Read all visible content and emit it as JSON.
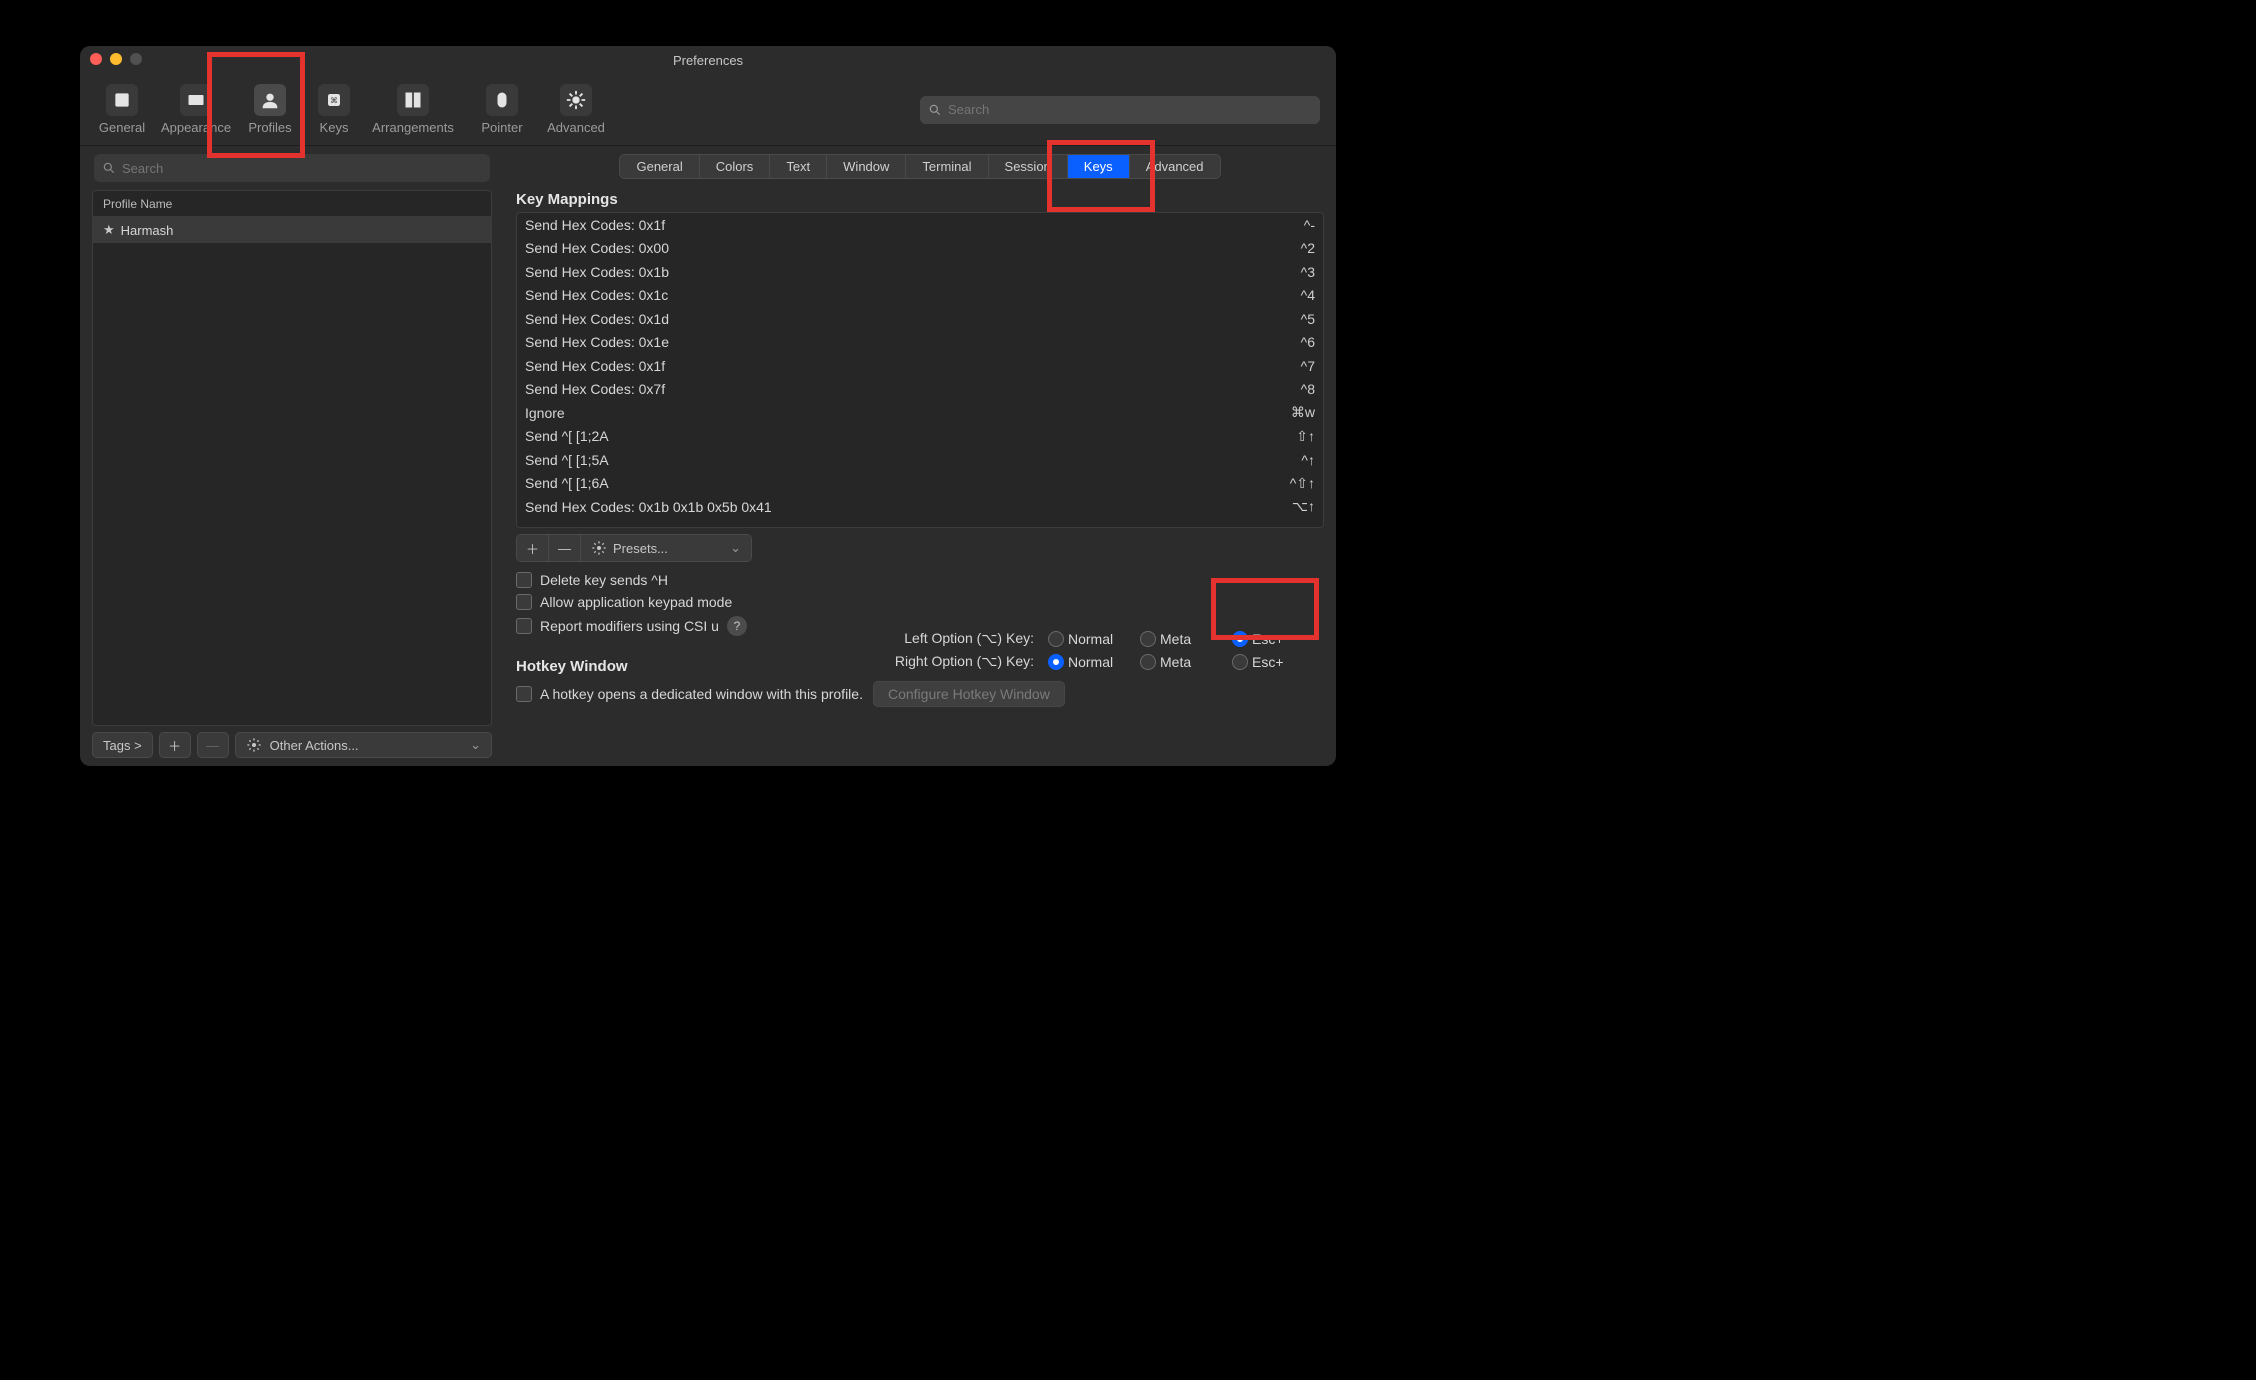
{
  "window": {
    "title": "Preferences"
  },
  "toolbar": {
    "items": [
      {
        "label": "General"
      },
      {
        "label": "Appearance"
      },
      {
        "label": "Profiles"
      },
      {
        "label": "Keys"
      },
      {
        "label": "Arrangements"
      },
      {
        "label": "Pointer"
      },
      {
        "label": "Advanced"
      }
    ],
    "search_placeholder": "Search"
  },
  "sidebar": {
    "search_placeholder": "Search",
    "header": "Profile Name",
    "rows": [
      "Harmash"
    ],
    "tags_label": "Tags >",
    "other_actions": "Other Actions..."
  },
  "tabs": [
    "General",
    "Colors",
    "Text",
    "Window",
    "Terminal",
    "Session",
    "Keys",
    "Advanced"
  ],
  "active_tab": "Keys",
  "key_mappings": {
    "heading": "Key Mappings",
    "rows": [
      {
        "action": "Send Hex Codes: 0x1f",
        "shortcut": "^-"
      },
      {
        "action": "Send Hex Codes: 0x00",
        "shortcut": "^2"
      },
      {
        "action": "Send Hex Codes: 0x1b",
        "shortcut": "^3"
      },
      {
        "action": "Send Hex Codes: 0x1c",
        "shortcut": "^4"
      },
      {
        "action": "Send Hex Codes: 0x1d",
        "shortcut": "^5"
      },
      {
        "action": "Send Hex Codes: 0x1e",
        "shortcut": "^6"
      },
      {
        "action": "Send Hex Codes: 0x1f",
        "shortcut": "^7"
      },
      {
        "action": "Send Hex Codes: 0x7f",
        "shortcut": "^8"
      },
      {
        "action": "Ignore",
        "shortcut": "⌘w"
      },
      {
        "action": "Send ^[ [1;2A",
        "shortcut": "⇧↑"
      },
      {
        "action": "Send ^[ [1;5A",
        "shortcut": "^↑"
      },
      {
        "action": "Send ^[ [1;6A",
        "shortcut": "^⇧↑"
      },
      {
        "action": "Send Hex Codes: 0x1b 0x1b 0x5b 0x41",
        "shortcut": "⌥↑"
      }
    ],
    "presets_label": "Presets..."
  },
  "checks": {
    "delete_sends_hH": "Delete key sends ^H",
    "allow_keypad": "Allow application keypad mode",
    "csi_u": "Report modifiers using CSI u"
  },
  "option_keys": {
    "left_label": "Left Option (⌥) Key:",
    "right_label": "Right Option (⌥) Key:",
    "normal": "Normal",
    "meta": "Meta",
    "escp": "Esc+",
    "left_selected": "Esc+",
    "right_selected": "Normal"
  },
  "hotkey": {
    "heading": "Hotkey Window",
    "check": "A hotkey opens a dedicated window with this profile.",
    "button": "Configure Hotkey Window"
  }
}
